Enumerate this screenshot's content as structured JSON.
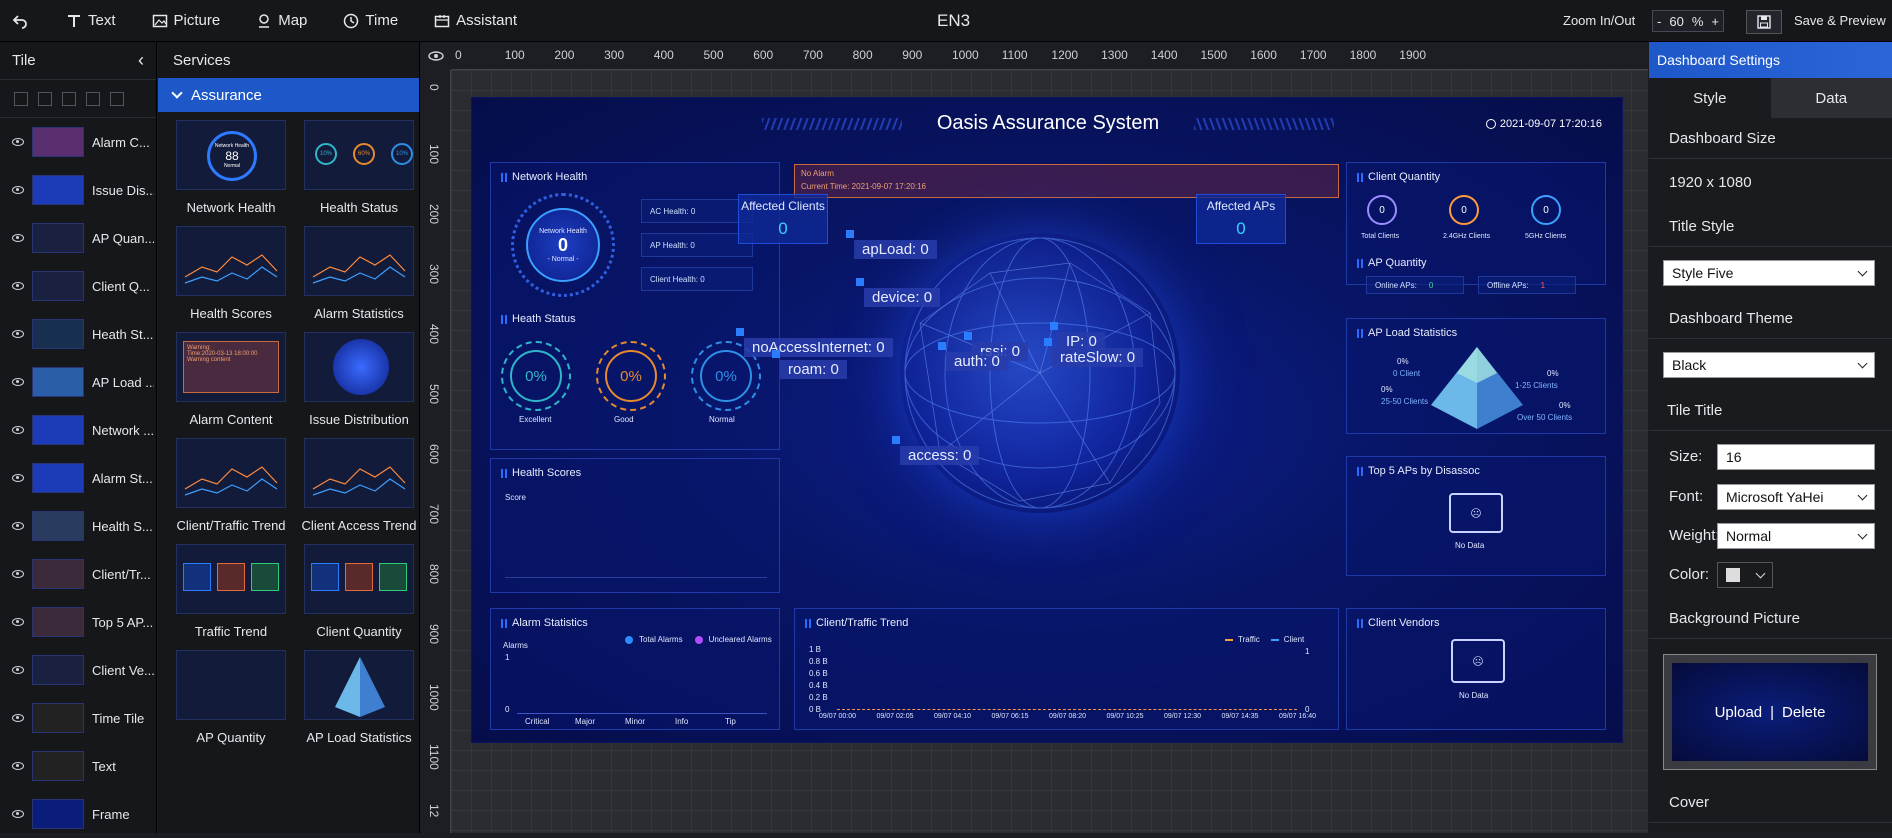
{
  "topbar": {
    "undo_label": "",
    "text_label": "Text",
    "picture_label": "Picture",
    "map_label": "Map",
    "time_label": "Time",
    "assistant_label": "Assistant",
    "doc_title": "EN3",
    "zoom_label": "Zoom In/Out",
    "zoom_minus": "-",
    "zoom_value": "60",
    "zoom_unit": "%",
    "zoom_plus": "+",
    "save_label": "Save & Preview"
  },
  "tile_panel": {
    "title": "Tile",
    "items": [
      {
        "label": "Alarm C..."
      },
      {
        "label": "Issue Dis..."
      },
      {
        "label": "AP Quan..."
      },
      {
        "label": "Client Q..."
      },
      {
        "label": "Heath St..."
      },
      {
        "label": "AP Load ..."
      },
      {
        "label": "Network ..."
      },
      {
        "label": "Alarm St..."
      },
      {
        "label": "Health S..."
      },
      {
        "label": "Client/Tr..."
      },
      {
        "label": "Top 5 AP..."
      },
      {
        "label": "Client Ve..."
      },
      {
        "label": "Time Tile"
      },
      {
        "label": "Text"
      },
      {
        "label": "Frame"
      }
    ]
  },
  "services_panel": {
    "title": "Services",
    "category": "Assurance",
    "items": [
      {
        "label": "Network Health"
      },
      {
        "label": "Health Status"
      },
      {
        "label": "Health Scores"
      },
      {
        "label": "Alarm Statistics"
      },
      {
        "label": "Alarm Content"
      },
      {
        "label": "Issue Distribution"
      },
      {
        "label": "Client/Traffic Trend"
      },
      {
        "label": "Client Access Trend"
      },
      {
        "label": "Traffic Trend"
      },
      {
        "label": "Client Quantity"
      },
      {
        "label": "AP Quantity"
      },
      {
        "label": "AP Load Statistics"
      }
    ],
    "thumb_texts": {
      "nh_title": "Network Health",
      "nh_value": "88",
      "nh_sub": "Normal",
      "hs_a": "10%",
      "hs_b": "60%",
      "hs_c": "10%",
      "ac_line1": "Warning:",
      "ac_line2": "Time:2020-03-13 18:00:00",
      "ac_line3": "Warning content"
    }
  },
  "ruler": {
    "top": [
      "0",
      "100",
      "200",
      "300",
      "400",
      "500",
      "600",
      "700",
      "800",
      "900",
      "1000",
      "1100",
      "1200",
      "1300",
      "1400",
      "1500",
      "1600",
      "1700",
      "1800",
      "1900"
    ],
    "left": [
      "0",
      "100",
      "200",
      "300",
      "400",
      "500",
      "600",
      "700",
      "800",
      "900",
      "1000",
      "1100",
      "12"
    ]
  },
  "dashboard": {
    "title": "Oasis Assurance System",
    "datetime": "2021-09-07 17:20:16",
    "network_health": {
      "title": "Network Health",
      "gauge_title": "Network Health",
      "gauge_value": "0",
      "gauge_status": "- Normal -",
      "ac": "AC Health: 0",
      "ap": "AP Health: 0",
      "client": "Client Health: 0"
    },
    "heath_status": {
      "title": "Heath Status",
      "items": [
        {
          "value": "0%",
          "label": "Excellent",
          "color": "#2fb6c9"
        },
        {
          "value": "0%",
          "label": "Good",
          "color": "#e68a2e"
        },
        {
          "value": "0%",
          "label": "Normal",
          "color": "#2e8fe6"
        }
      ]
    },
    "health_scores": {
      "title": "Health Scores",
      "axis": "Score"
    },
    "alarm_box": {
      "line1": "No Alarm",
      "line2": "Current Time: 2021-09-07 17:20:16"
    },
    "affected_clients": {
      "label": "Affected Clients",
      "value": "0"
    },
    "affected_aps": {
      "label": "Affected APs",
      "value": "0"
    },
    "globe_labels": [
      {
        "text": "apLoad: 0"
      },
      {
        "text": "device: 0"
      },
      {
        "text": "noAccessInternet: 0"
      },
      {
        "text": "roam: 0"
      },
      {
        "text": "rssi: 0"
      },
      {
        "text": "auth: 0"
      },
      {
        "text": "IP: 0"
      },
      {
        "text": "rateSlow: 0"
      },
      {
        "text": "access: 0"
      }
    ],
    "client_quantity": {
      "title": "Client Quantity",
      "items": [
        {
          "value": "0",
          "label": "Total Clients",
          "color": "#9b8cff"
        },
        {
          "value": "0",
          "label": "2.4GHz Clients",
          "color": "#ff9a3c"
        },
        {
          "value": "0",
          "label": "5GHz Clients",
          "color": "#3ca0ff"
        }
      ]
    },
    "ap_quantity": {
      "title": "AP Quantity",
      "online": "Online APs:",
      "online_value": "0",
      "offline": "Offline APs:",
      "offline_value": "1"
    },
    "ap_load": {
      "title": "AP Load Statistics",
      "l1": "0%",
      "l1b": "0 Client",
      "r1": "0%",
      "r1b": "1-25 Clients",
      "l2": "0%",
      "l2b": "25-50 Clients",
      "r2": "0%",
      "r2b": "Over 50 Clients"
    },
    "top5": {
      "title": "Top 5 APs by Disassoc",
      "empty": "No Data"
    },
    "alarm_stats": {
      "title": "Alarm Statistics",
      "axis": "Alarms",
      "legend_total": "Total Alarms",
      "legend_uncleared": "Uncleared Alarms",
      "y_top": "1",
      "y_bottom": "0",
      "categories": [
        "Critical",
        "Major",
        "Minor",
        "Info",
        "Tip"
      ]
    },
    "client_traffic": {
      "title": "Client/Traffic Trend",
      "legend_traffic": "Traffic",
      "legend_client": "Client",
      "y_left": [
        "1 B",
        "0.8 B",
        "0.6 B",
        "0.4 B",
        "0.2 B",
        "0 B"
      ],
      "y_right_top": "1",
      "y_right_bottom": "0",
      "x": [
        "09/07 00:00",
        "09/07 02:05",
        "09/07 04:10",
        "09/07 06:15",
        "09/07 08:20",
        "09/07 10:25",
        "09/07 12:30",
        "09/07 14:35",
        "09/07 16:40"
      ]
    },
    "client_vendors": {
      "title": "Client Vendors",
      "empty": "No Data"
    }
  },
  "settings": {
    "title": "Dashboard Settings",
    "tab_style": "Style",
    "tab_data": "Data",
    "dashboard_size_label": "Dashboard Size",
    "dashboard_size_value": "1920 x 1080",
    "title_style_label": "Title Style",
    "title_style_value": "Style Five",
    "theme_label": "Dashboard Theme",
    "theme_value": "Black",
    "tile_title_label": "Tile Title",
    "size_label": "Size:",
    "size_value": "16",
    "font_label": "Font:",
    "font_value": "Microsoft YaHei",
    "weight_label": "Weight:",
    "weight_value": "Normal",
    "color_label": "Color:",
    "bg_label": "Background Picture",
    "upload": "Upload",
    "sep": "|",
    "delete": "Delete",
    "cover_label": "Cover"
  }
}
